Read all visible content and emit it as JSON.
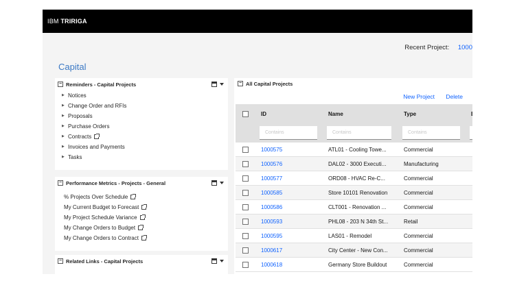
{
  "brand": {
    "prefix": "IBM",
    "name": "TRIRIGA"
  },
  "recent": {
    "label": "Recent Project:",
    "value": "1000"
  },
  "page_title": "Capital",
  "reminders": {
    "title": "Reminders - Capital Projects",
    "items": [
      {
        "label": "Notices",
        "external": false
      },
      {
        "label": "Change Order and RFIs",
        "external": false
      },
      {
        "label": "Proposals",
        "external": false
      },
      {
        "label": "Purchase Orders",
        "external": false
      },
      {
        "label": "Contracts",
        "external": true
      },
      {
        "label": "Invoices and Payments",
        "external": false
      },
      {
        "label": "Tasks",
        "external": false
      }
    ]
  },
  "metrics": {
    "title": "Performance Metrics - Projects - General",
    "items": [
      {
        "label": "% Projects Over Schedule"
      },
      {
        "label": "My Current Budget to Forecast"
      },
      {
        "label": "My Project Schedule Variance"
      },
      {
        "label": "My Change Orders to Budget"
      },
      {
        "label": "My Change Orders to Contract"
      }
    ]
  },
  "related": {
    "title": "Related Links - Capital Projects"
  },
  "grid": {
    "title": "All Capital Projects",
    "actions": {
      "new": "New Project",
      "delete": "Delete"
    },
    "columns": {
      "id": "ID",
      "name": "Name",
      "type": "Type",
      "extra": "E"
    },
    "filters": {
      "id": "Contains",
      "name": "Contains",
      "type": "Contains"
    },
    "rows": [
      {
        "id": "1000575",
        "name": "ATL01 - Cooling Towe...",
        "type": "Commercial"
      },
      {
        "id": "1000576",
        "name": "DAL02 - 3000 Executi...",
        "type": "Manufacturing"
      },
      {
        "id": "1000577",
        "name": "ORD08 - HVAC Re-C...",
        "type": "Commercial"
      },
      {
        "id": "1000585",
        "name": "Store 10101 Renovation",
        "type": "Commercial"
      },
      {
        "id": "1000586",
        "name": "CLT001 - Renovation ...",
        "type": "Commercial"
      },
      {
        "id": "1000593",
        "name": "PHL08 - 203 N 34th St...",
        "type": "Retail"
      },
      {
        "id": "1000595",
        "name": "LAS01 - Remodel",
        "type": "Commercial"
      },
      {
        "id": "1000617",
        "name": "City Center - New Con...",
        "type": "Commercial"
      },
      {
        "id": "1000618",
        "name": "Germany Store Buildout",
        "type": "Commercial"
      }
    ]
  }
}
